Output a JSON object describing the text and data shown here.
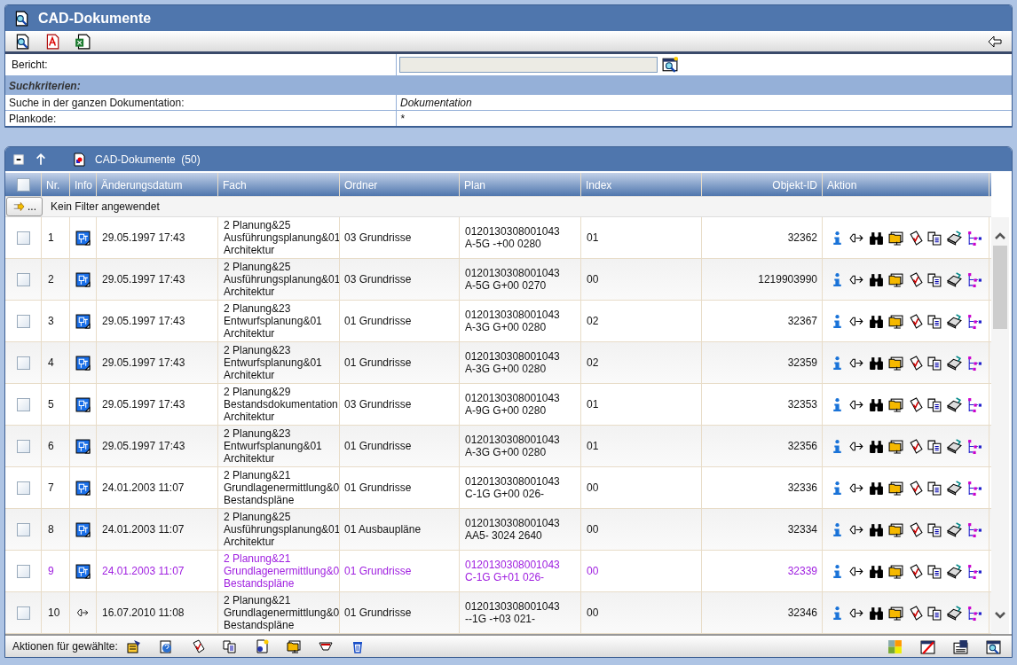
{
  "window": {
    "title": "CAD-Dokumente"
  },
  "report": {
    "label": "Bericht:"
  },
  "criteria": {
    "heading": "Suchkriterien:",
    "rows": [
      {
        "label": "Suche in der ganzen Dokumentation:",
        "value": "Dokumentation"
      },
      {
        "label": "Plankode:",
        "value": "*"
      }
    ]
  },
  "list": {
    "title": "CAD-Dokumente",
    "count": "(50)",
    "filter_text": "Kein Filter angewendet",
    "filter_button": "...",
    "columns": [
      "Nr.",
      "Info",
      "Änderungsdatum",
      "Fach",
      "Ordner",
      "Plan",
      "Index",
      "Objekt-ID",
      "Aktion"
    ],
    "all_checked": false,
    "rows": [
      {
        "checked": false,
        "highlighted": false,
        "nr": "1",
        "kind": "plan",
        "date": "29.05.1997 17:43",
        "fach": [
          "2 Planung&25",
          "Ausführungsplanung&01",
          "Architektur"
        ],
        "ordner": "03 Grundrisse",
        "plan": [
          "0120130308001043",
          "A-5G -+00 0280"
        ],
        "index": "01",
        "objekt_id": "32362"
      },
      {
        "checked": false,
        "highlighted": false,
        "nr": "2",
        "kind": "plan",
        "date": "29.05.1997 17:43",
        "fach": [
          "2 Planung&25",
          "Ausführungsplanung&01",
          "Architektur"
        ],
        "ordner": "03 Grundrisse",
        "plan": [
          "0120130308001043",
          "A-5G G+00 0270"
        ],
        "index": "00",
        "objekt_id": "1219903990"
      },
      {
        "checked": false,
        "highlighted": false,
        "nr": "3",
        "kind": "plan",
        "date": "29.05.1997 17:43",
        "fach": [
          "2 Planung&23",
          "Entwurfsplanung&01",
          "Architektur"
        ],
        "ordner": "01 Grundrisse",
        "plan": [
          "0120130308001043",
          "A-3G G+00 0280"
        ],
        "index": "02",
        "objekt_id": "32367"
      },
      {
        "checked": false,
        "highlighted": false,
        "nr": "4",
        "kind": "plan",
        "date": "29.05.1997 17:43",
        "fach": [
          "2 Planung&23",
          "Entwurfsplanung&01",
          "Architektur"
        ],
        "ordner": "01 Grundrisse",
        "plan": [
          "0120130308001043",
          "A-3G G+00 0280"
        ],
        "index": "02",
        "objekt_id": "32359"
      },
      {
        "checked": false,
        "highlighted": false,
        "nr": "5",
        "kind": "plan",
        "date": "29.05.1997 17:43",
        "fach": [
          "2 Planung&29",
          "Bestandsdokumentation",
          "Architektur"
        ],
        "ordner": "03 Grundrisse",
        "plan": [
          "0120130308001043",
          "A-9G G+00 0280"
        ],
        "index": "01",
        "objekt_id": "32353"
      },
      {
        "checked": false,
        "highlighted": false,
        "nr": "6",
        "kind": "plan",
        "date": "29.05.1997 17:43",
        "fach": [
          "2 Planung&23",
          "Entwurfsplanung&01",
          "Architektur"
        ],
        "ordner": "01 Grundrisse",
        "plan": [
          "0120130308001043",
          "A-3G G+00 0280"
        ],
        "index": "01",
        "objekt_id": "32356"
      },
      {
        "checked": false,
        "highlighted": false,
        "nr": "7",
        "kind": "plan",
        "date": "24.01.2003 11:07",
        "fach": [
          "2 Planung&21",
          "Grundlagenermittlung&0",
          "Bestandspläne"
        ],
        "ordner": "01 Grundrisse",
        "plan": [
          "0120130308001043",
          "C-1G G+00 026-"
        ],
        "index": "00",
        "objekt_id": "32336"
      },
      {
        "checked": false,
        "highlighted": false,
        "nr": "8",
        "kind": "plan",
        "date": "24.01.2003 11:07",
        "fach": [
          "2 Planung&25",
          "Ausführungsplanung&01",
          "Architektur"
        ],
        "ordner": "01 Ausbaupläne",
        "plan": [
          "0120130308001043",
          "AA5- 3024 2640"
        ],
        "index": "00",
        "objekt_id": "32334"
      },
      {
        "checked": false,
        "highlighted": true,
        "nr": "9",
        "kind": "plan",
        "date": "24.01.2003 11:07",
        "fach": [
          "2 Planung&21",
          "Grundlagenermittlung&0",
          "Bestandspläne"
        ],
        "ordner": "01 Grundrisse",
        "plan": [
          "0120130308001043",
          "C-1G G+01 026-"
        ],
        "index": "00",
        "objekt_id": "32339"
      },
      {
        "checked": false,
        "highlighted": false,
        "nr": "10",
        "kind": "link",
        "date": "16.07.2010 11:08",
        "fach": [
          "2 Planung&21",
          "Grundlagenermittlung&0",
          "Bestandspläne"
        ],
        "ordner": "01 Grundrisse",
        "plan": [
          "0120130308001043",
          "--1G -+03 021-"
        ],
        "index": "00",
        "objekt_id": "32346"
      }
    ],
    "footer_label": "Aktionen für gewählte:"
  }
}
